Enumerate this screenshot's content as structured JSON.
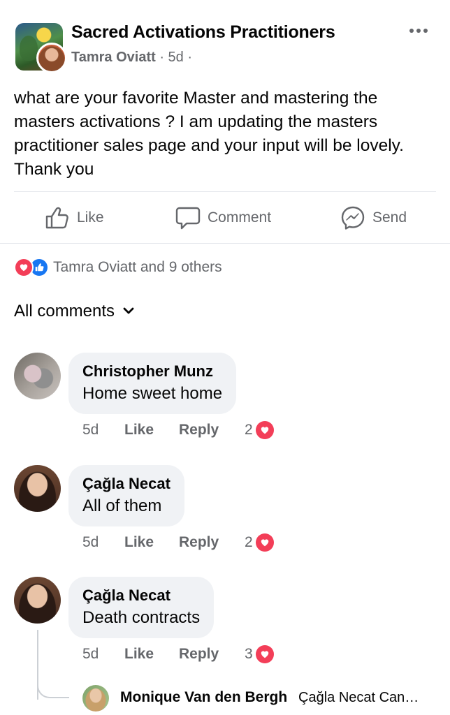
{
  "post": {
    "group_name": "Sacred Activations Practitioners",
    "poster": "Tamra Oviatt",
    "time": " · 5d · ",
    "more_icon": "more-dots-icon",
    "body": "what are your favorite Master and mastering the masters activations ? I am updating the masters practitioner sales page and your input will be lovely. Thank you"
  },
  "actions": {
    "like": "Like",
    "comment": "Comment",
    "send": "Send"
  },
  "reactions": {
    "summary": "Tamra Oviatt and 9 others",
    "types": [
      "love",
      "like"
    ]
  },
  "comments_header": "All comments",
  "comments": [
    {
      "name": "Christopher Munz",
      "text": "Home sweet home",
      "time": "5d",
      "like": "Like",
      "reply": "Reply",
      "reaction_count": "2"
    },
    {
      "name": "Çağla Necat",
      "text": "All of them",
      "time": "5d",
      "like": "Like",
      "reply": "Reply",
      "reaction_count": "2"
    },
    {
      "name": "Çağla Necat",
      "text": "Death contracts",
      "time": "5d",
      "like": "Like",
      "reply": "Reply",
      "reaction_count": "3"
    }
  ],
  "reply_preview": {
    "name": "Monique Van den Bergh",
    "snippet": "Çağla Necat Can…"
  },
  "colors": {
    "primary_text": "#050505",
    "secondary_text": "#65676b",
    "bubble": "#f0f2f5",
    "love": "#f33e58",
    "like": "#1877f2"
  }
}
